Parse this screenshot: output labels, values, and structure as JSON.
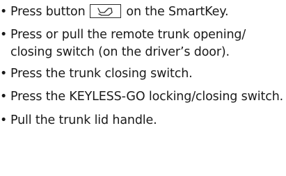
{
  "bullet_char": "•",
  "items": [
    {
      "before": "Press button",
      "icon": "trunk-open-icon",
      "after": "on the SmartKey."
    },
    {
      "text": "Press or pull the remote trunk opening/ closing switch (on the driver’s door)."
    },
    {
      "text": "Press the trunk closing switch."
    },
    {
      "text": "Press the KEYLESS-GO locking/closing switch."
    },
    {
      "text": "Pull the trunk lid handle."
    }
  ]
}
